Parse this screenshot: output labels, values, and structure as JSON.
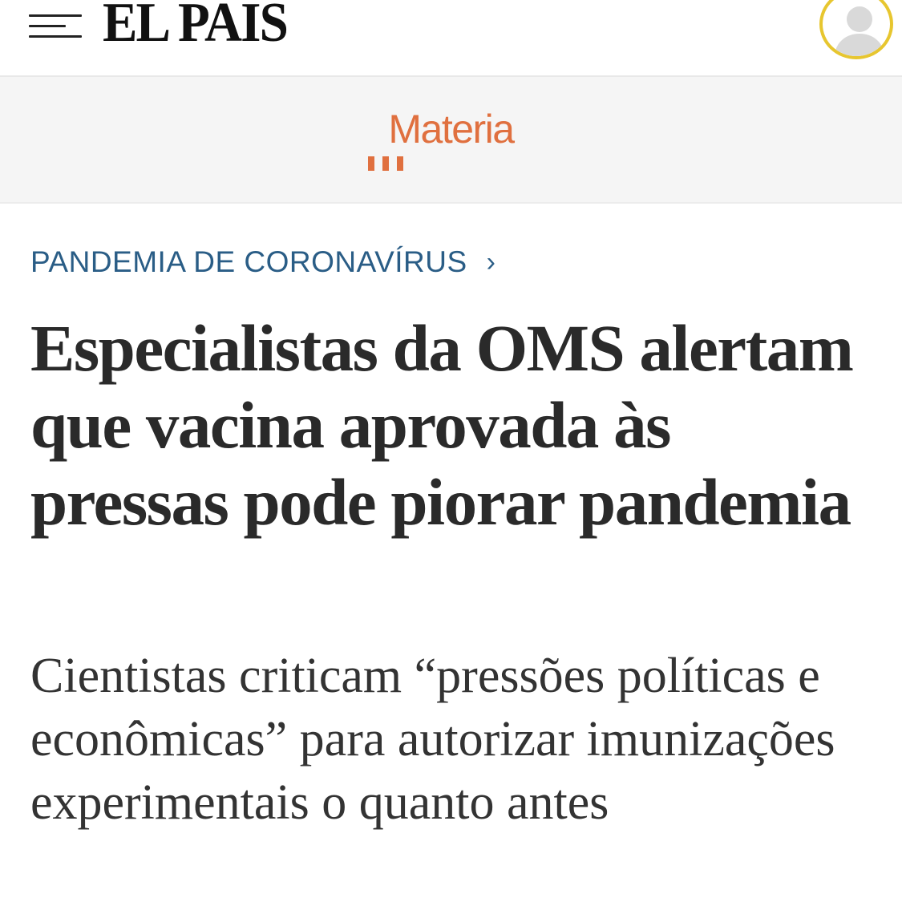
{
  "header": {
    "logo": "EL PAIS",
    "menu_icon": "hamburger-menu-icon",
    "avatar_icon": "user-avatar-icon",
    "avatar_ring_color": "#e7c62f"
  },
  "section": {
    "label": "Materia",
    "color": "#e0703f"
  },
  "article": {
    "kicker": "PANDEMIA DE CORONAVÍRUS",
    "kicker_arrow": "›",
    "kicker_color": "#2a5d86",
    "headline": "Especialistas da OMS alertam que vacina aprovada às pressas pode piorar pandemia",
    "subheadline": "Cientistas criticam “pressões políticas e econômicas” para autorizar imunizações experimentais o quanto antes"
  }
}
